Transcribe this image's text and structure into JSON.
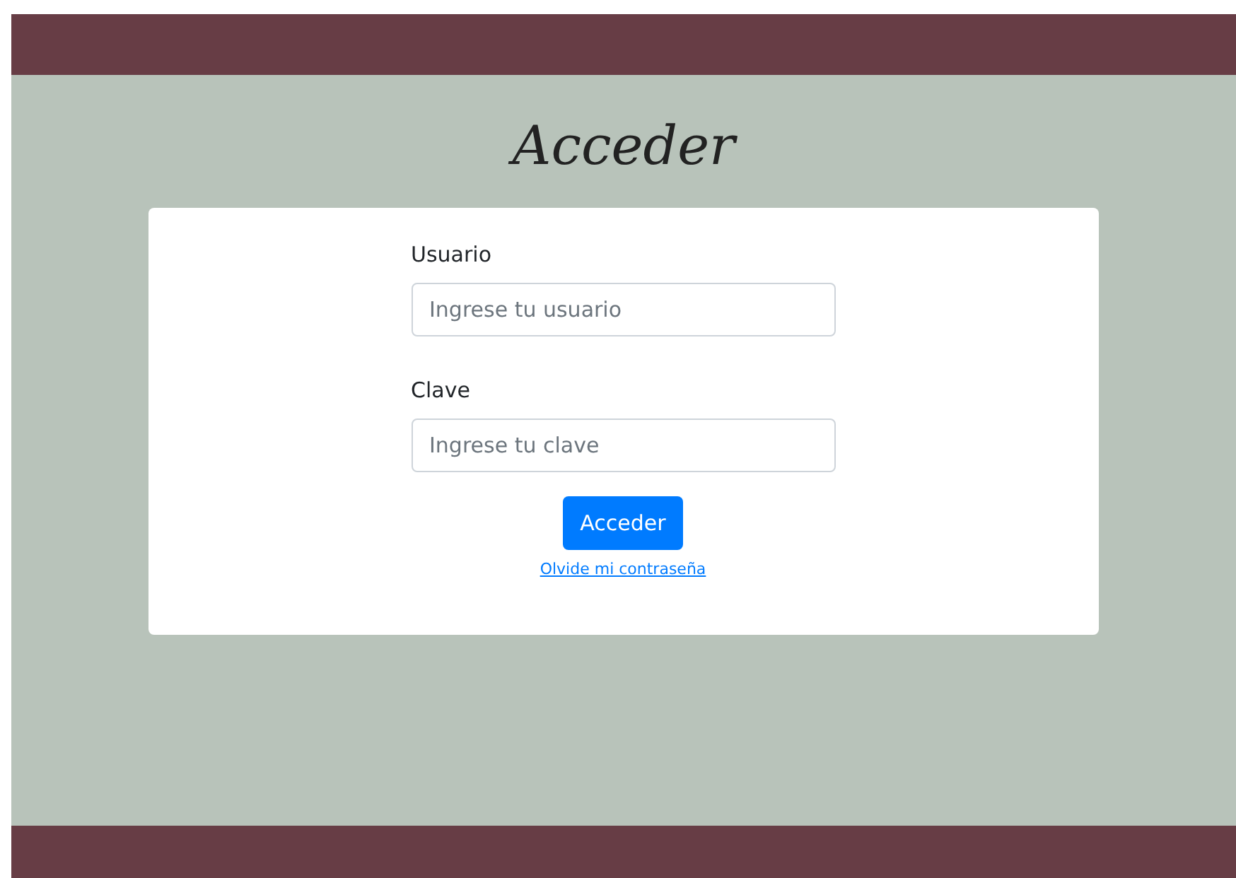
{
  "title": "Acceder",
  "fields": [
    {
      "label": "Usuario",
      "placeholder": "Ingrese tu usuario"
    },
    {
      "label": "Clave",
      "placeholder": "Ingrese tu clave"
    }
  ],
  "submit": "Acceder",
  "link": "Olvide mi contraseña"
}
